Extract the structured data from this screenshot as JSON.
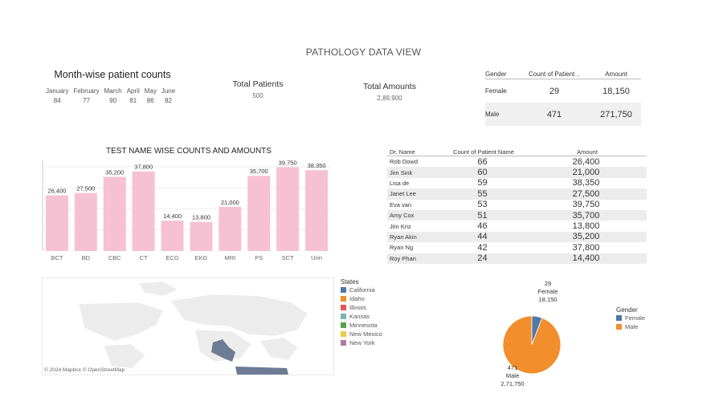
{
  "dashboard_title": "PATHOLOGY DATA VIEW",
  "month_wise": {
    "title": "Month-wise patient counts",
    "months": [
      {
        "label": "January",
        "value": "84"
      },
      {
        "label": "February",
        "value": "77"
      },
      {
        "label": "March",
        "value": "90"
      },
      {
        "label": "April",
        "value": "81"
      },
      {
        "label": "May",
        "value": "86"
      },
      {
        "label": "June",
        "value": "82"
      }
    ]
  },
  "total_patients": {
    "label": "Total Patients",
    "value": "500"
  },
  "total_amounts": {
    "label": "Total Amounts",
    "value": "2,89,900"
  },
  "gender_table": {
    "headers": [
      "Gender",
      "Count of Patient ..",
      "Amount"
    ],
    "rows": [
      {
        "gender": "Female",
        "count": "29",
        "amount": "18,150"
      },
      {
        "gender": "Male",
        "count": "471",
        "amount": "271,750"
      }
    ]
  },
  "doctor_table": {
    "headers": [
      "Dr. Name",
      "Count of Patient Name",
      "Amount"
    ],
    "rows": [
      {
        "name": "Rob Dowd",
        "count": "66",
        "amount": "26,400"
      },
      {
        "name": "Jim Sink",
        "count": "60",
        "amount": "21,000"
      },
      {
        "name": "Lisa de",
        "count": "59",
        "amount": "38,350"
      },
      {
        "name": "Janet Lee",
        "count": "55",
        "amount": "27,500"
      },
      {
        "name": "Eva van",
        "count": "53",
        "amount": "39,750"
      },
      {
        "name": "Amy Cox",
        "count": "51",
        "amount": "35,700"
      },
      {
        "name": "Jim Kriz",
        "count": "46",
        "amount": "13,800"
      },
      {
        "name": "Ryan Akin",
        "count": "44",
        "amount": "35,200"
      },
      {
        "name": "Ryan Ng",
        "count": "42",
        "amount": "37,800"
      },
      {
        "name": "Roy Phan",
        "count": "24",
        "amount": "14,400"
      }
    ]
  },
  "map": {
    "attribution": "© 2024 Mapbox © OpenStreetMap",
    "legend_title": "States",
    "states": [
      {
        "name": "California",
        "color": "#4e79a7"
      },
      {
        "name": "Idaho",
        "color": "#f28e2b"
      },
      {
        "name": "Illinois",
        "color": "#e15759"
      },
      {
        "name": "Kansas",
        "color": "#76b7b2"
      },
      {
        "name": "Minnesota",
        "color": "#59a14f"
      },
      {
        "name": "New Mexico",
        "color": "#edc948"
      },
      {
        "name": "New York",
        "color": "#b07aa1"
      }
    ]
  },
  "gender_legend": {
    "title": "Gender",
    "items": [
      {
        "name": "Female",
        "color": "#4e79a7"
      },
      {
        "name": "Male",
        "color": "#f28e2b"
      }
    ]
  },
  "chart_data": [
    {
      "type": "bar",
      "title": "TEST NAME WISE COUNTS AND AMOUNTS",
      "categories": [
        "BCT",
        "BD",
        "CBC",
        "CT",
        "ECG",
        "EKG",
        "MRI",
        "PS",
        "SCT",
        "Urin"
      ],
      "values": [
        26400,
        27500,
        35200,
        37800,
        14400,
        13800,
        21000,
        35700,
        39750,
        38350
      ],
      "value_labels": [
        "26,400",
        "27,500",
        "35,200",
        "37,800",
        "14,400",
        "13,800",
        "21,000",
        "35,700",
        "39,750",
        "38,350"
      ],
      "ylim": [
        0,
        43000
      ],
      "grid": true,
      "color": "#f7c1d4"
    },
    {
      "type": "pie",
      "slices": [
        {
          "name": "Female",
          "count": "29",
          "amount": "18,150",
          "value": 29,
          "color": "#4e79a7"
        },
        {
          "name": "Male",
          "count": "471",
          "amount": "2,71,750",
          "value": 471,
          "color": "#f28e2b"
        }
      ],
      "legend_title": "Gender",
      "legend": "right"
    }
  ]
}
